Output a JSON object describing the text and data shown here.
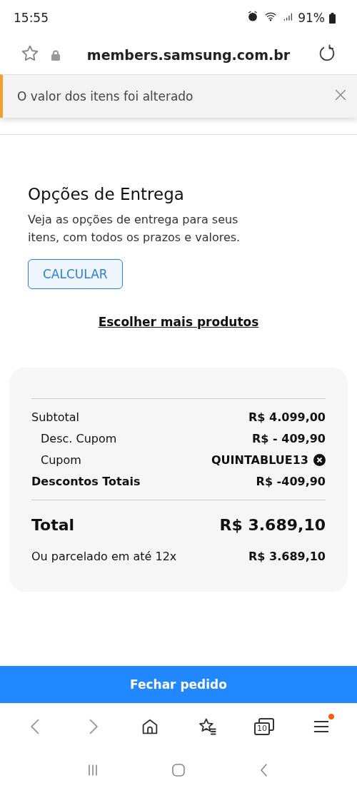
{
  "status_bar": {
    "time": "15:55",
    "battery": "91%"
  },
  "address_bar": {
    "url": "members.samsung.com.br"
  },
  "toast": {
    "message": "O valor dos itens foi alterado"
  },
  "delivery": {
    "title": "Opções de Entrega",
    "description": "Veja as opções de entrega para seus itens, com todos os prazos e valores.",
    "button": "CALCULAR"
  },
  "more_products_link": "Escolher mais produtos",
  "summary": {
    "rows": [
      {
        "kind": "plain",
        "label": "Subtotal",
        "value": "R$ 4.099,00"
      },
      {
        "kind": "indented",
        "label": "Desc. Cupom",
        "value": "R$ - 409,90"
      },
      {
        "kind": "coupon",
        "label": "Cupom",
        "value": "QUINTABLUE13"
      },
      {
        "kind": "bold",
        "label": "Descontos Totais",
        "value": "R$ -409,90"
      }
    ],
    "total_label": "Total",
    "total_value": "R$ 3.689,10",
    "installment_label": "Ou parcelado em até 12x",
    "installment_value": "R$ 3.689,10"
  },
  "checkout_button": "Fechar pedido",
  "browser_toolbar": {
    "tabs_count": "10",
    "menu_badge": true
  }
}
